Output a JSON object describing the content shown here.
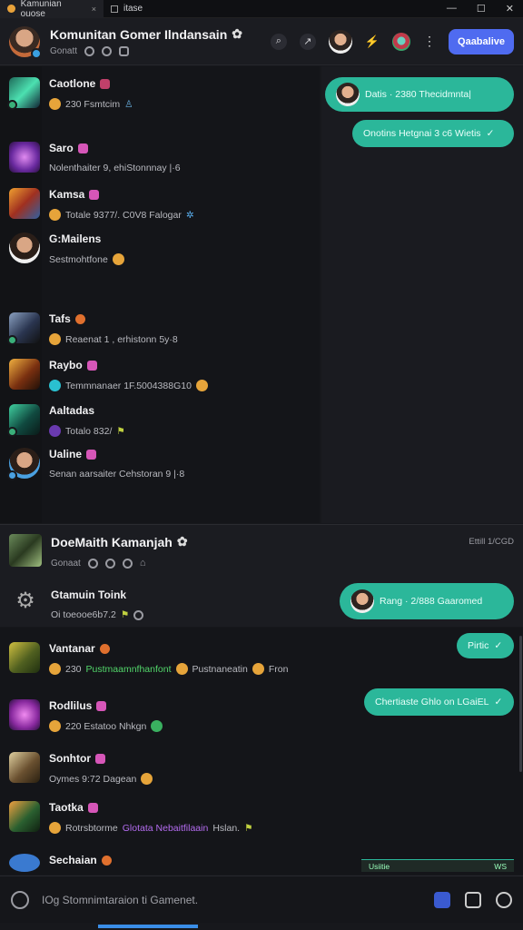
{
  "tabs": [
    {
      "label": "Kamunian ouose",
      "close": "×"
    },
    {
      "label": "itase"
    }
  ],
  "window": {
    "minimize": "—",
    "maximize": "☐",
    "close": "✕"
  },
  "header": {
    "title": "Komunitan Gomer Ilndansain",
    "subtitle": "Gonatt",
    "cta": "Qaabalive"
  },
  "list_top": [
    {
      "name": "Caotlone",
      "preview": "230  Fsmtcim"
    },
    {
      "name": "Saro",
      "preview": "Nolenthaiter 9, ehiStonnnay |·6"
    },
    {
      "name": "Kamsa",
      "preview": "Totale 9377/.   C0V8   Falogar"
    },
    {
      "name": "G:Mailens",
      "preview": "Sestmohtfone"
    },
    {
      "name": "Tafs",
      "preview": "Reaenat 1 , erhistonn 5y·8"
    },
    {
      "name": "Raybo",
      "preview": "Temmnanaer  1F.5004388G10"
    },
    {
      "name": "Aaltadas",
      "preview": "Totalo 832/"
    },
    {
      "name": "Ualine",
      "preview": "Senan aarsaiter Cehstoran 9 |·8"
    }
  ],
  "bubbles_top": [
    {
      "text": "Datis  ·  2380  Thecidmnta|"
    },
    {
      "text": "Onotins Hetgnai 3 c6 Wietis"
    }
  ],
  "section2": {
    "title": "DoeMaith Kamanjah",
    "subtitle": "Gonaat",
    "timestamp": "Ettill 1/CGD"
  },
  "group": {
    "name": "Gtamuin Toink",
    "preview": "Oi  toeooe6b7.2"
  },
  "bubbles_mid": [
    {
      "text": "Rang  ·  2/888  Gaaromed"
    }
  ],
  "list_bottom": [
    {
      "name": "Vantanar",
      "preview_a": "230",
      "preview_green": "Pustmaamnfhanfont",
      "preview_b": "Pustnaneatin",
      "preview_c": "Fron"
    },
    {
      "name": "Rodlilus",
      "preview": "220   Estatoo    Nhkgn"
    },
    {
      "name": "Sonhtor",
      "preview": "Oymes  9:72    Dagean"
    },
    {
      "name": "Taotka",
      "preview_a": "Rotrsbtorme",
      "preview_purple": "Glotata Nebaitfilaain",
      "preview_b": "Hslan."
    },
    {
      "name": "Sechaian",
      "preview": ""
    }
  ],
  "bubbles_bottom": [
    {
      "text": "Pirtic"
    },
    {
      "text": "Chertiaste Ghlo on LGaiEL"
    }
  ],
  "strip": {
    "left": "Usiitie",
    "right": "WS"
  },
  "composer": {
    "placeholder": "IOg Stomnimtaraion ti Gamenet."
  }
}
